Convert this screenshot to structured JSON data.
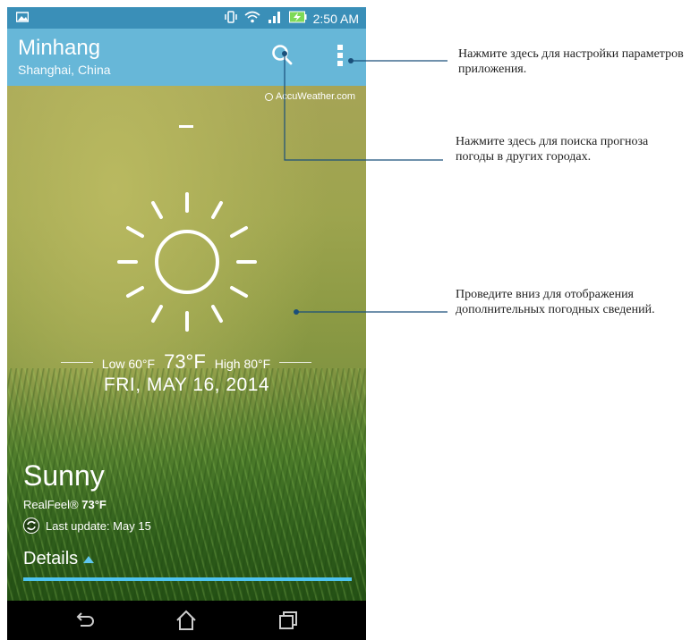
{
  "status_bar": {
    "time": "2:50 AM"
  },
  "app_bar": {
    "city": "Minhang",
    "region": "Shanghai, China"
  },
  "weather": {
    "provider": "AccuWeather.com",
    "low": "Low 60°F",
    "current": "73°F",
    "high": "High 80°F",
    "date": "FRI, MAY 16, 2014",
    "condition": "Sunny",
    "realfeel_label": "RealFeel®",
    "realfeel_value": "73°F",
    "last_update": "Last update: May 15",
    "details_label": "Details"
  },
  "annotations": {
    "menu": "Нажмите здесь для настройки параметров приложения.",
    "search": "Нажмите здесь для поиска прогноза погоды в других городах.",
    "swipe": "Проведите вниз для отображения дополнительных погодных сведений."
  },
  "colors": {
    "status_bar": "#3a8fb8",
    "app_bar": "#67b7d8",
    "accent": "#4dc4ef"
  }
}
